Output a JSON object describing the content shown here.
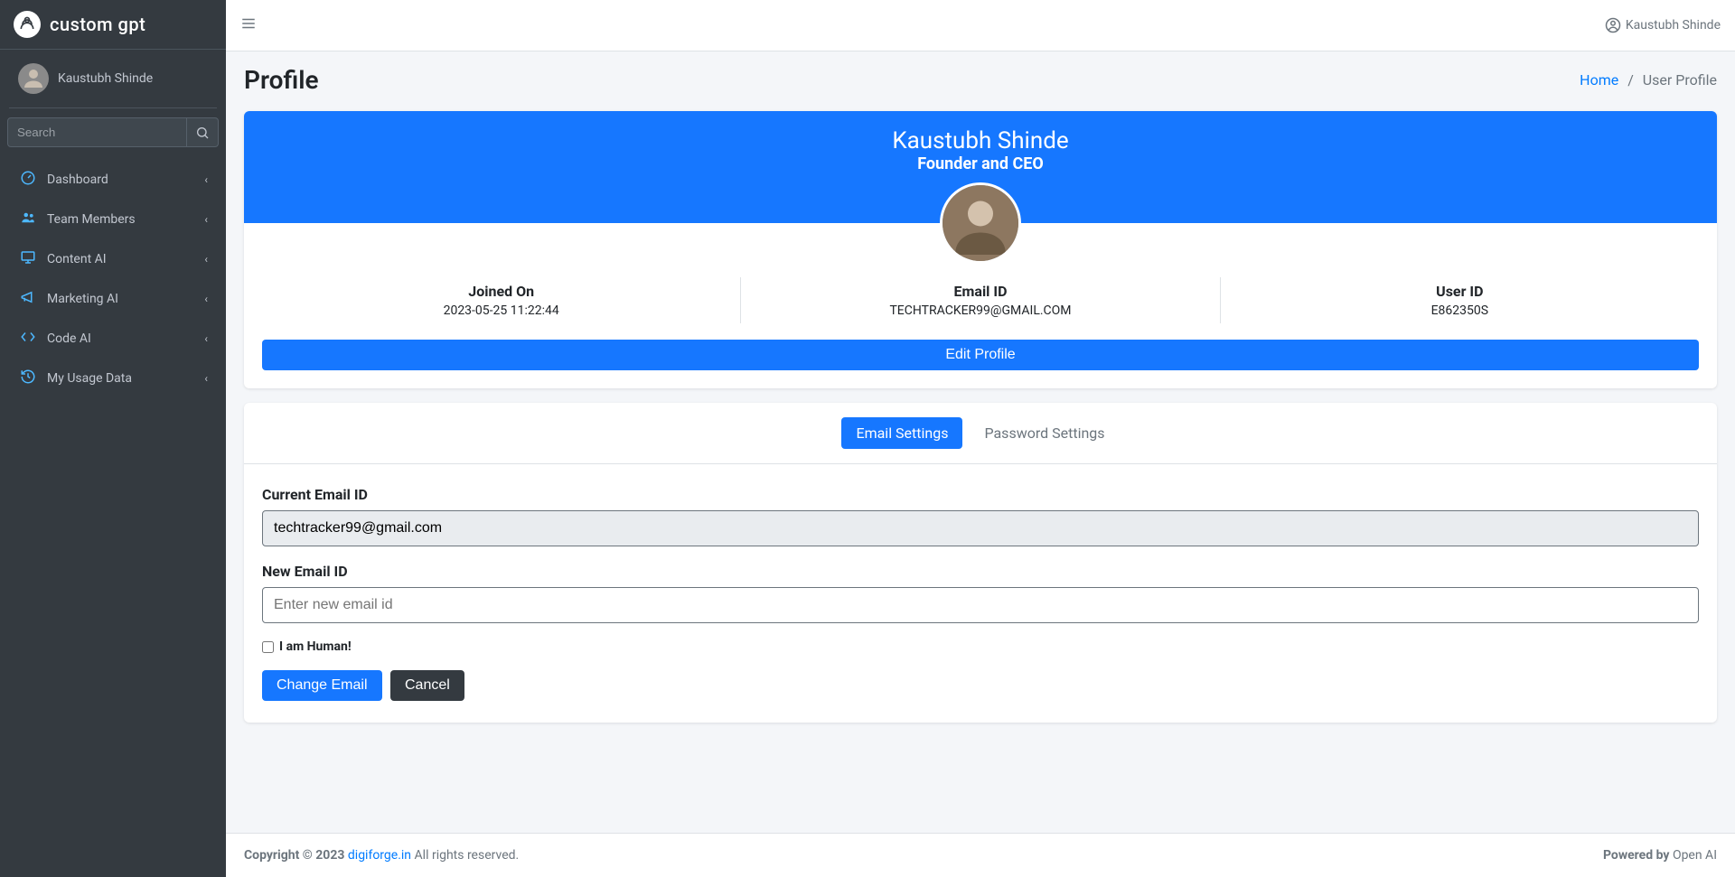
{
  "brand": {
    "name": "custom gpt"
  },
  "user": {
    "name": "Kaustubh Shinde"
  },
  "search": {
    "placeholder": "Search"
  },
  "header": {
    "username": "Kaustubh Shinde"
  },
  "sidebar": {
    "items": [
      {
        "label": "Dashboard",
        "icon": "gauge"
      },
      {
        "label": "Team Members",
        "icon": "users"
      },
      {
        "label": "Content AI",
        "icon": "monitor"
      },
      {
        "label": "Marketing AI",
        "icon": "megaphone"
      },
      {
        "label": "Code AI",
        "icon": "code"
      },
      {
        "label": "My Usage Data",
        "icon": "history"
      }
    ]
  },
  "page": {
    "title": "Profile",
    "breadcrumb_home": "Home",
    "breadcrumb_current": "User Profile"
  },
  "profile": {
    "name": "Kaustubh Shinde",
    "subtitle": "Founder and CEO",
    "joined_label": "Joined On",
    "joined_value": "2023-05-25 11:22:44",
    "email_label": "Email ID",
    "email_value": "TECHTRACKER99@GMAIL.COM",
    "userid_label": "User ID",
    "userid_value": "E862350S",
    "edit_button": "Edit Profile"
  },
  "tabs": {
    "email": "Email Settings",
    "password": "Password Settings"
  },
  "form": {
    "current_label": "Current Email ID",
    "current_value": "techtracker99@gmail.com",
    "new_label": "New Email ID",
    "new_placeholder": "Enter new email id",
    "human_label": "I am Human!",
    "submit": "Change Email",
    "cancel": "Cancel"
  },
  "footer": {
    "copyright": "Copyright © 2023 ",
    "link": "digiforge.in",
    "rights": " All rights reserved.",
    "powered_label": "Powered by ",
    "powered_value": "Open AI"
  }
}
